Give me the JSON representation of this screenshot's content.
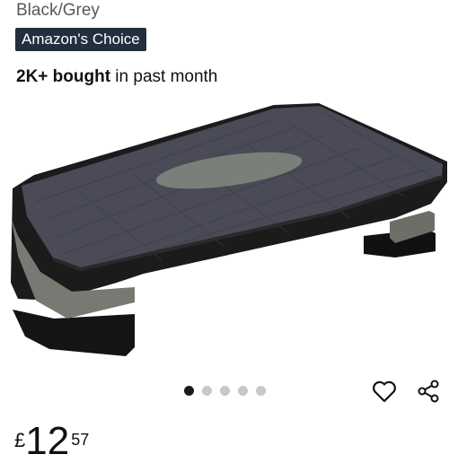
{
  "product": {
    "variant": "Black/Grey",
    "badge": "Amazon's Choice",
    "social_proof_bold": "2K+ bought",
    "social_proof_rest": " in past month",
    "image_icon": "aerobic-step-platform"
  },
  "gallery": {
    "current_index": 1,
    "total": 5
  },
  "actions": {
    "wishlist_icon": "heart-outline-icon",
    "share_icon": "share-icon"
  },
  "price": {
    "currency": "£",
    "whole": "12",
    "fraction": "57"
  },
  "colors": {
    "badge_bg": "#232f3e",
    "text_primary": "#0f1111",
    "text_secondary": "#565959",
    "dot_active": "#1a1a1a",
    "dot_inactive": "#c8c8c8"
  }
}
